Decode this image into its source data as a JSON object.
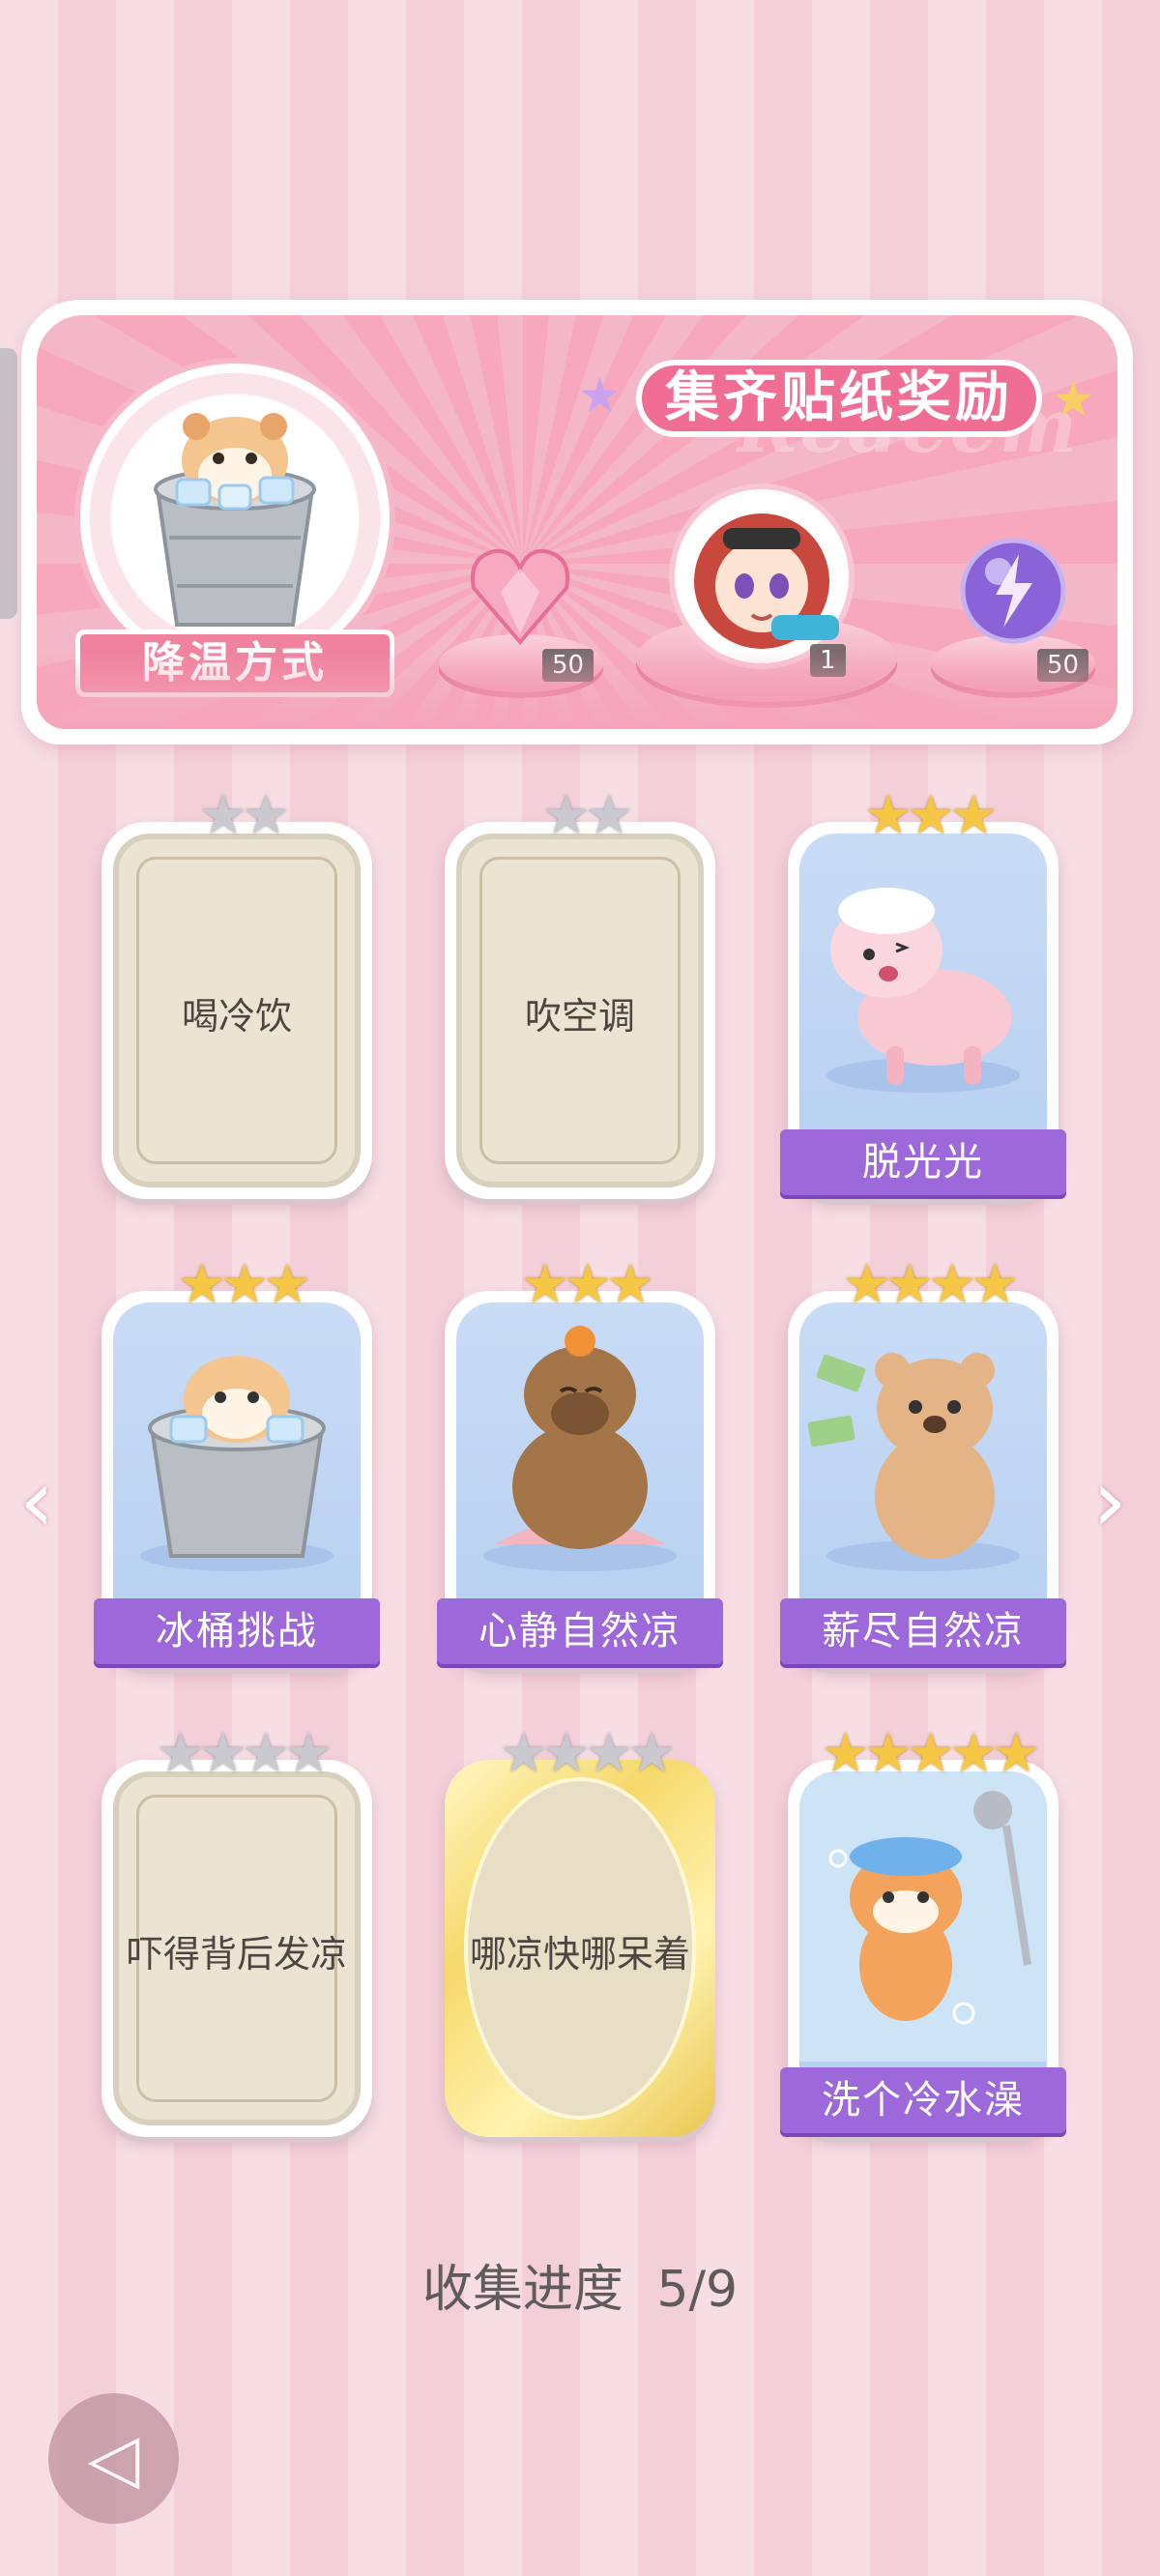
{
  "banner": {
    "title": "集齐贴纸奖励",
    "watermark": "Redeem",
    "category_label": "降温方式",
    "rewards": [
      {
        "icon": "pink-heart-gem-icon",
        "count": "50"
      },
      {
        "icon": "character-avatar-icon",
        "count": "1"
      },
      {
        "icon": "purple-lightning-orb-icon",
        "count": "50"
      }
    ]
  },
  "stickers": [
    {
      "label": "喝冷饮",
      "stars": 2,
      "collected": false,
      "style": "blank"
    },
    {
      "label": "吹空调",
      "stars": 2,
      "collected": false,
      "style": "blank"
    },
    {
      "label": "脱光光",
      "stars": 3,
      "collected": true,
      "style": "art",
      "art": "sheep"
    },
    {
      "label": "冰桶挑战",
      "stars": 3,
      "collected": true,
      "style": "art",
      "art": "hamster-bucket"
    },
    {
      "label": "心静自然凉",
      "stars": 3,
      "collected": true,
      "style": "art",
      "art": "capybara"
    },
    {
      "label": "薪尽自然凉",
      "stars": 4,
      "collected": true,
      "style": "art",
      "art": "bear"
    },
    {
      "label": "吓得背后发凉",
      "stars": 4,
      "collected": false,
      "style": "blank"
    },
    {
      "label": "哪凉快哪呆着",
      "stars": 4,
      "collected": false,
      "style": "gold"
    },
    {
      "label": "洗个冷水澡",
      "stars": 5,
      "collected": true,
      "style": "art",
      "art": "cat-shower"
    }
  ],
  "progress": {
    "label": "收集进度",
    "value": "5/9"
  },
  "nav": {
    "prev_icon": "chevron-left-icon",
    "next_icon": "chevron-right-icon",
    "back_icon": "back-arrow-icon"
  },
  "colors": {
    "ribbon": "#9d68d9",
    "banner_pink": "#f06e93",
    "star_gold": "#f6c745",
    "star_grey": "#c9c9cf"
  }
}
